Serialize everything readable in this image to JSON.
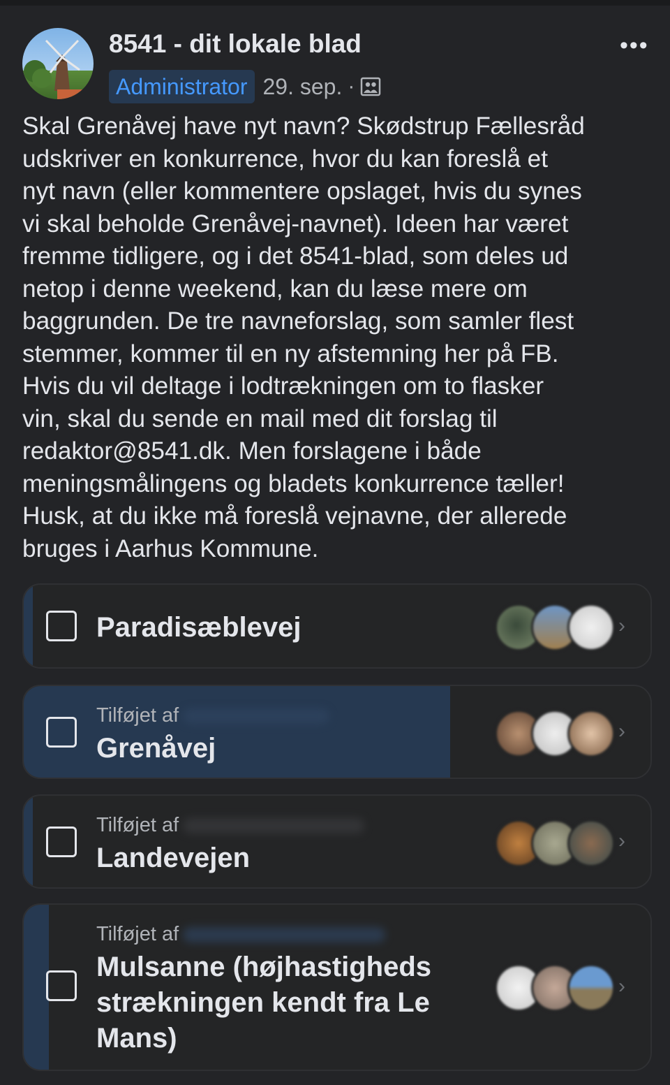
{
  "post": {
    "page_name": "8541 - dit lokale blad",
    "role_badge": "Administrator",
    "date": "29. sep.",
    "separator": "·",
    "audience_icon": "group-icon",
    "more_icon": "•••",
    "text": "Skal Grenåvej have nyt navn? Skødstrup Fællesråd\nudskriver en konkurrence, hvor du kan foreslå et\nnyt navn (eller kommentere opslaget, hvis du synes\nvi skal beholde Grenåvej-navnet). Ideen har været\nfremme tidligere, og i det 8541-blad, som deles ud\nnetop i denne weekend, kan du læse mere om\nbaggrunden. De tre navneforslag, som samler flest\nstemmer, kommer til en ny afstemning her på FB.\nHvis du vil deltage i lodtrækningen om to flasker\nvin, skal du sende en mail med dit forslag til\nredaktor@8541.dk. Men forslagene i både\nmeningsmålingens og bladets konkurrence tæller!\nHusk, at du ikke må foreslå vejnavne, der allerede\nbruges i Aarhus Kommune."
  },
  "poll": {
    "options": [
      {
        "label": "Paradisæblevej",
        "added_by": "",
        "vote_share": 0.015
      },
      {
        "label": "Grenåvej",
        "added_by": "Tilføjet af",
        "vote_share": 0.68
      },
      {
        "label": "Landevejen",
        "added_by": "Tilføjet af",
        "vote_share": 0.015
      },
      {
        "label": "Mulsanne (højhastigheds\nstrækningen kendt fra Le\nMans)",
        "added_by": "Tilføjet af",
        "vote_share": 0.04
      }
    ],
    "chevron_icon": "›",
    "colors": {
      "vote_fill": "#263951",
      "badge_text": "#4599ff"
    }
  }
}
